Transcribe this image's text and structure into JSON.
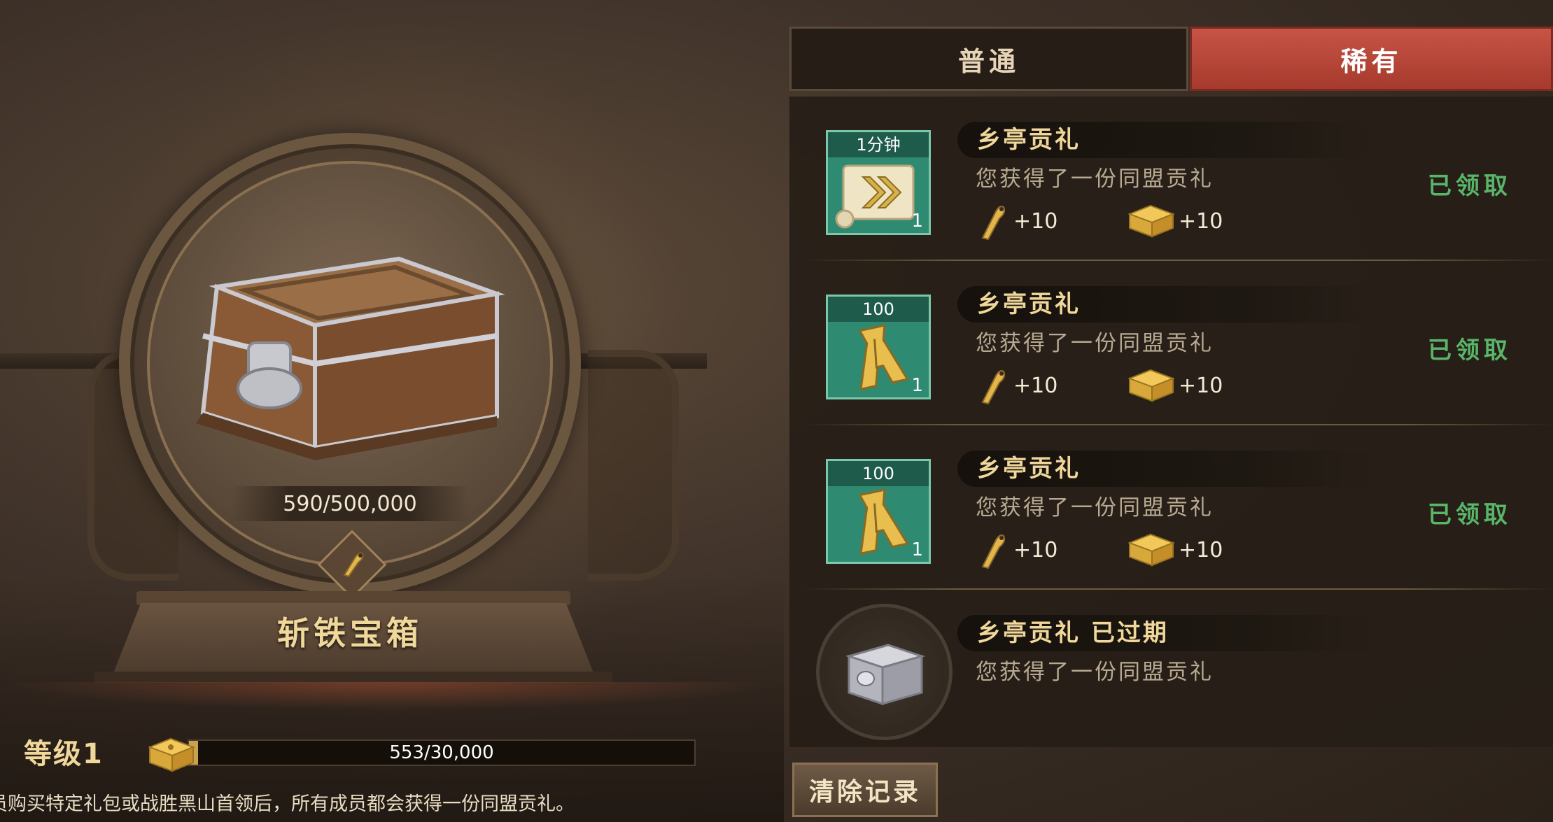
{
  "chest": {
    "name": "斩铁宝箱",
    "progress_text": "590/500,000",
    "progress_value": 0.00118
  },
  "level": {
    "label": "等级1",
    "progress_text": "553/30,000",
    "progress_value": 0.0184
  },
  "footer_note": "员购买特定礼包或战胜黑山首领后，所有成员都会获得一份同盟贡礼。",
  "tabs": [
    {
      "label": "普通",
      "active": false
    },
    {
      "label": "稀有",
      "active": true
    }
  ],
  "entries": [
    {
      "icon_name": "scroll-speedup-icon",
      "icon_label": "1分钟",
      "count": "1",
      "title": "乡亭贡礼",
      "description": "您获得了一份同盟贡礼",
      "rewards": [
        {
          "icon": "dagger-icon",
          "text": "+10"
        },
        {
          "icon": "gold-ingot-icon",
          "text": "+10"
        }
      ],
      "status": "已领取"
    },
    {
      "icon_name": "spade-coin-icon",
      "icon_label": "100",
      "count": "1",
      "title": "乡亭贡礼",
      "description": "您获得了一份同盟贡礼",
      "rewards": [
        {
          "icon": "dagger-icon",
          "text": "+10"
        },
        {
          "icon": "gold-ingot-icon",
          "text": "+10"
        }
      ],
      "status": "已领取"
    },
    {
      "icon_name": "spade-coin-icon",
      "icon_label": "100",
      "count": "1",
      "title": "乡亭贡礼",
      "description": "您获得了一份同盟贡礼",
      "rewards": [
        {
          "icon": "dagger-icon",
          "text": "+10"
        },
        {
          "icon": "gold-ingot-icon",
          "text": "+10"
        }
      ],
      "status": "已领取"
    },
    {
      "icon_name": "silver-chest-icon",
      "title": "乡亭贡礼 已过期",
      "description": "您获得了一份同盟贡礼"
    }
  ],
  "clear_button": "清除记录",
  "colors": {
    "accent_gold": "#f0d79a",
    "claimed_green": "#58b569",
    "rare_tab_red": "#c75445",
    "item_teal": "#2f8a72"
  }
}
